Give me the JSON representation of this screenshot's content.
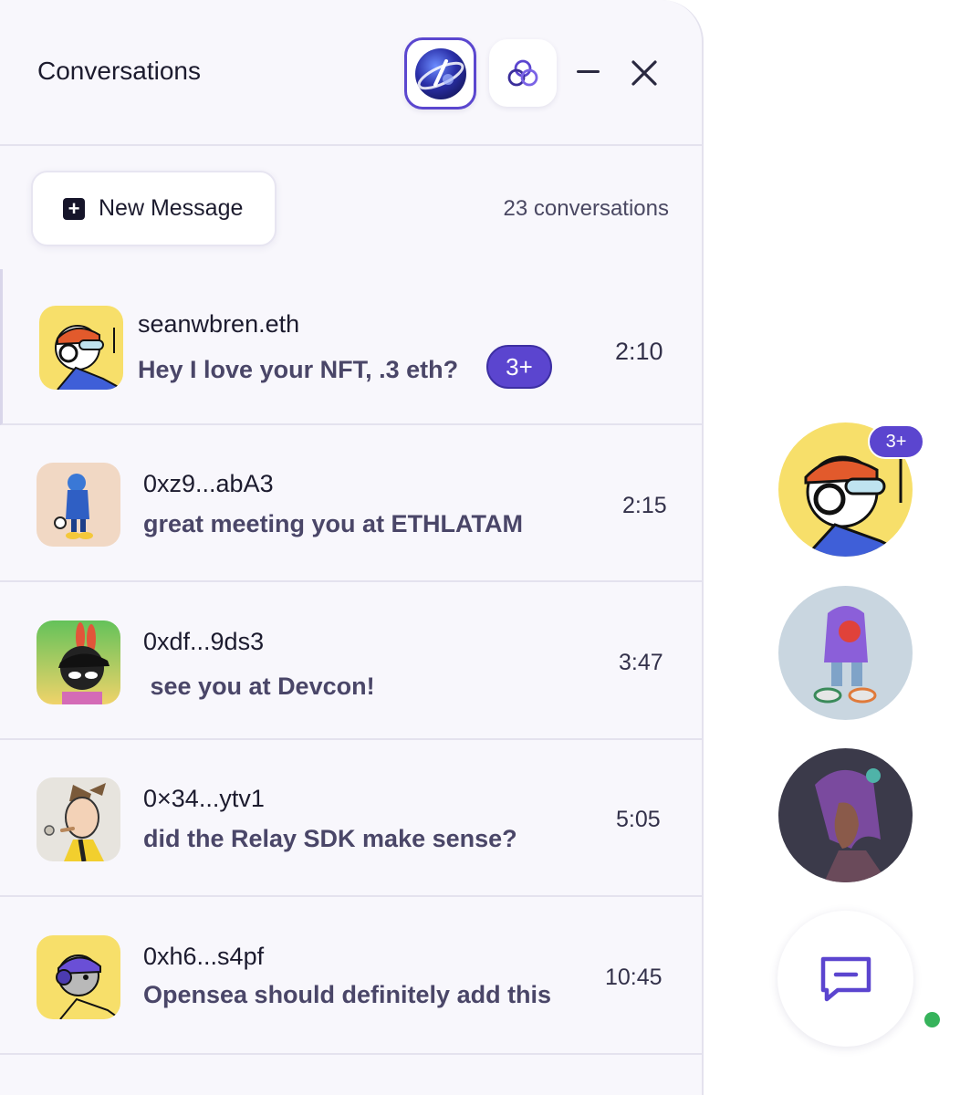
{
  "header": {
    "title": "Conversations"
  },
  "toolbar": {
    "new_message_label": "New Message",
    "conversation_count": "23 conversations"
  },
  "conversations": [
    {
      "name": "seanwbren.eth",
      "preview": "Hey I love your NFT, .3 eth?",
      "time": "2:10",
      "badge": "3+"
    },
    {
      "name": "0xz9...abA3",
      "preview": "great meeting you at ETHLATAM",
      "time": "2:15"
    },
    {
      "name": "0xdf...9ds3",
      "preview": " see you at Devcon!",
      "time": "3:47"
    },
    {
      "name": "0×34...ytv1",
      "preview": "did the Relay SDK make sense?",
      "time": "5:05"
    },
    {
      "name": "0xh6...s4pf",
      "preview": "Opensea should definitely add this",
      "time": "10:45"
    }
  ],
  "sidebar": {
    "badge": "3+"
  },
  "colors": {
    "accent": "#5b45cf",
    "panel_bg": "#f8f7fc",
    "online": "#36b35b"
  },
  "icons": [
    "minimize-icon",
    "close-icon",
    "relay-logo-icon",
    "plus-icon",
    "chat-bubble-icon"
  ]
}
